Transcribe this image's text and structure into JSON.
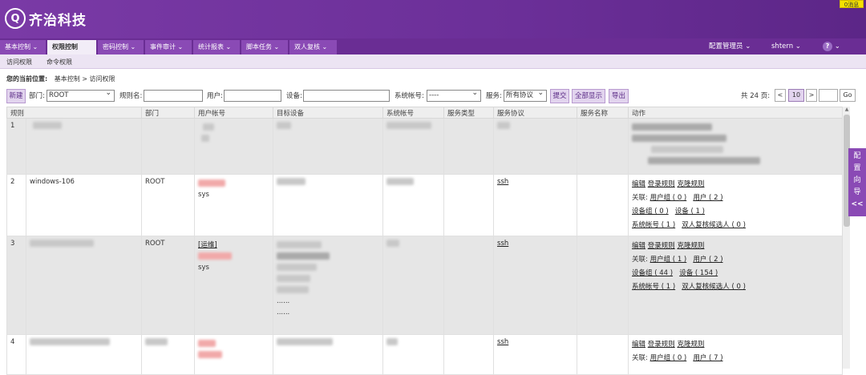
{
  "brand": {
    "name": "齐治科技",
    "mark": "Q"
  },
  "message_badge": "0消息",
  "nav": {
    "items": [
      "基本控制 ⌄",
      "权限控制",
      "密码控制 ⌄",
      "事件审计 ⌄",
      "统计报表 ⌄",
      "脚本任务 ⌄",
      "双人复核 ⌄"
    ],
    "active_index": 1,
    "role": "配置管理员 ⌄",
    "user": "shtern ⌄",
    "help": "?",
    "help_caret": "⌄"
  },
  "subnav": [
    "访问权限",
    "命令权限"
  ],
  "breadcrumb": {
    "label": "您的当前位置:",
    "path": "基本控制 > 访问权限"
  },
  "toolbar": {
    "new_button": "新建",
    "dept_label": "部门:",
    "dept_value": "ROOT",
    "rule_label": "规则名:",
    "user_label": "用户:",
    "device_label": "设备:",
    "sysacct_label": "系统帐号:",
    "sysacct_value": "----",
    "service_label": "服务:",
    "service_value": "所有协议",
    "submit": "提交",
    "show_all": "全部显示",
    "export": "导出",
    "pager_total": "共 24 页:",
    "pager_prev": "<",
    "pager_current": "10",
    "pager_next": ">",
    "pager_go": "Go"
  },
  "table": {
    "headers": [
      "规则",
      "",
      "部门",
      "用户帐号",
      "目标设备",
      "系统帐号",
      "服务类型",
      "服务协议",
      "服务名称",
      "动作"
    ],
    "rows": [
      {
        "num": "1",
        "name": "",
        "dept": "",
        "user_tag": "",
        "user_sys": "",
        "protocol": "",
        "links": false
      },
      {
        "num": "2",
        "name": "windows-106",
        "dept": "ROOT",
        "user_tag": "",
        "user_sys": "sys",
        "protocol": "ssh",
        "links": true,
        "edit": "编辑",
        "login_rule": "登录规则",
        "clone": "克隆规则",
        "assoc": "关联:",
        "user_group": "用户组 ( 0 )",
        "users": "用户 ( 2 )",
        "device_group": "设备组 ( 0 )",
        "devices": "设备 ( 1 )",
        "sys_accounts": "系统帐号 ( 1 )",
        "reviewers": "双人复核候选人 ( 0 )"
      },
      {
        "num": "3",
        "name": "",
        "dept": "ROOT",
        "user_tag": "[运维]",
        "user_sys": "sys",
        "protocol": "ssh",
        "links": true,
        "edit": "编辑",
        "login_rule": "登录规则",
        "clone": "克隆规则",
        "assoc": "关联:",
        "user_group": "用户组 ( 1 )",
        "users": "用户 ( 2 )",
        "device_group": "设备组 ( 44 )",
        "devices": "设备 ( 154 )",
        "sys_accounts": "系统帐号 ( 1 )",
        "reviewers": "双人复核候选人 ( 0 )",
        "device_more1": "......",
        "device_more2": "......"
      },
      {
        "num": "4",
        "name": "",
        "dept": "",
        "user_tag": "",
        "user_sys": "",
        "protocol": "ssh",
        "links": true,
        "edit": "编辑",
        "login_rule": "登录规则",
        "clone": "克隆规则",
        "assoc": "关联:",
        "user_group": "用户组 ( 0 )",
        "users": "用户 ( 7 )"
      }
    ]
  },
  "side_wizard": {
    "label": [
      "配",
      "置",
      "向",
      "导"
    ],
    "collapse": "<<"
  }
}
